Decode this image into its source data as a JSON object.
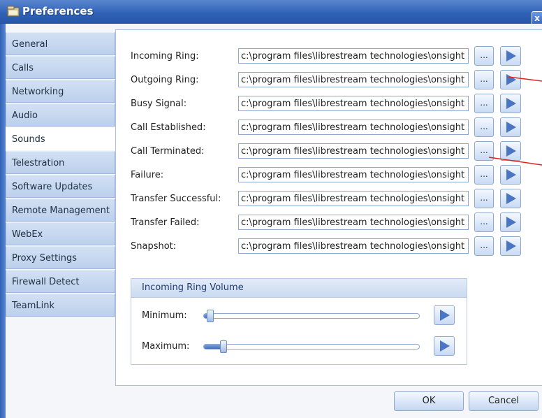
{
  "window": {
    "title": "Preferences",
    "close_label": "x"
  },
  "sidebar": {
    "items": [
      {
        "label": "General"
      },
      {
        "label": "Calls"
      },
      {
        "label": "Networking"
      },
      {
        "label": "Audio"
      },
      {
        "label": "Sounds",
        "active": true
      },
      {
        "label": "Telestration"
      },
      {
        "label": "Software Updates"
      },
      {
        "label": "Remote Management"
      },
      {
        "label": "WebEx"
      },
      {
        "label": "Proxy Settings"
      },
      {
        "label": "Firewall Detect"
      },
      {
        "label": "TeamLink"
      }
    ]
  },
  "sounds": {
    "browse_label": "...",
    "rows": [
      {
        "label": "Incoming Ring:",
        "path": "c:\\program files\\librestream technologies\\onsight e"
      },
      {
        "label": "Outgoing Ring:",
        "path": "c:\\program files\\librestream technologies\\onsight e"
      },
      {
        "label": "Busy Signal:",
        "path": "c:\\program files\\librestream technologies\\onsight e"
      },
      {
        "label": "Call Established:",
        "path": "c:\\program files\\librestream technologies\\onsight e"
      },
      {
        "label": "Call Terminated:",
        "path": "c:\\program files\\librestream technologies\\onsight e"
      },
      {
        "label": "Failure:",
        "path": "c:\\program files\\librestream technologies\\onsight e"
      },
      {
        "label": "Transfer Successful:",
        "path": "c:\\program files\\librestream technologies\\onsight e"
      },
      {
        "label": "Transfer Failed:",
        "path": "c:\\program files\\librestream technologies\\onsight e"
      },
      {
        "label": "Snapshot:",
        "path": "c:\\program files\\librestream technologies\\onsight e"
      }
    ]
  },
  "volume": {
    "title": "Incoming Ring Volume",
    "minimum_label": "Minimum:",
    "maximum_label": "Maximum:",
    "minimum_level": 0.03,
    "maximum_level": 0.09
  },
  "buttons": {
    "ok": "OK",
    "cancel": "Cancel"
  },
  "colors": {
    "accent": "#2f62b6",
    "play_triangle": "#4a75c4",
    "annotation": "#e0221b"
  }
}
